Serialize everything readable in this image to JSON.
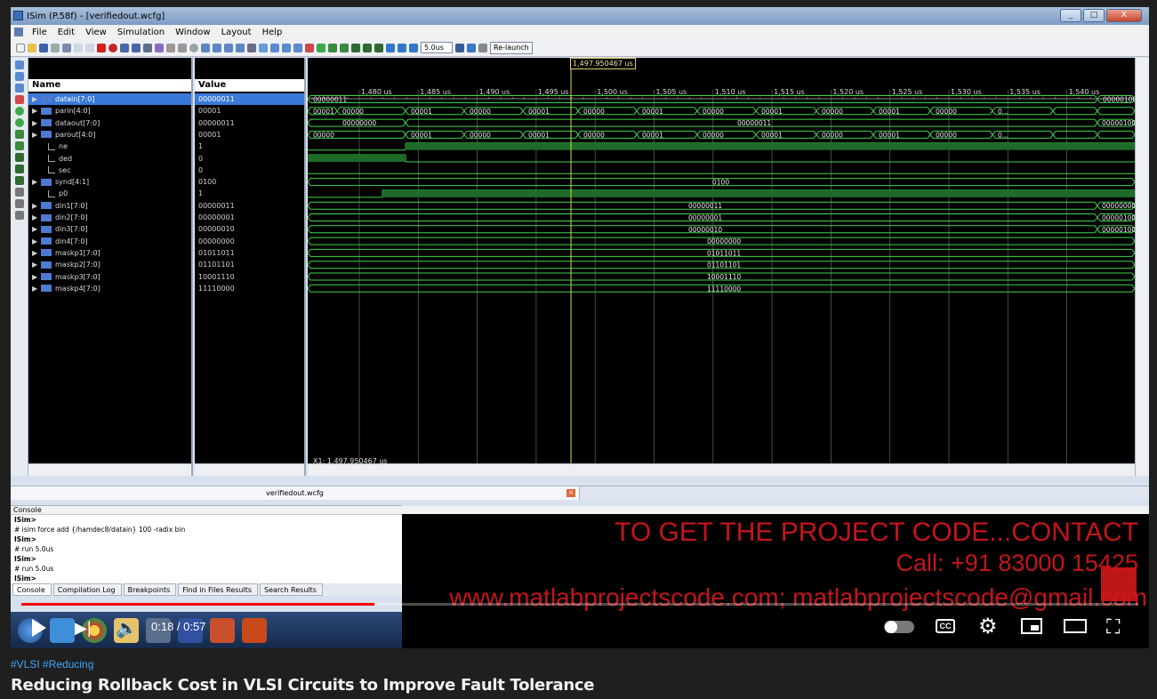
{
  "window": {
    "title": "ISim (P.58f) - [verifiedout.wcfg]",
    "controls": [
      "_",
      "□",
      "X"
    ]
  },
  "menu": [
    "File",
    "Edit",
    "View",
    "Simulation",
    "Window",
    "Layout",
    "Help"
  ],
  "toolbar": {
    "run_time": "5.0us",
    "relaunch_label": "Re-launch"
  },
  "panes": {
    "name_header": "Name",
    "value_header": "Value"
  },
  "signals": [
    {
      "name": "datain[7:0]",
      "value": "00000011",
      "bus": true,
      "selected": true
    },
    {
      "name": "parin[4:0]",
      "value": "00001",
      "bus": true
    },
    {
      "name": "dataout[7:0]",
      "value": "00000011",
      "bus": true
    },
    {
      "name": "parout[4:0]",
      "value": "00001",
      "bus": true
    },
    {
      "name": "ne",
      "value": "1",
      "bus": false
    },
    {
      "name": "ded",
      "value": "0",
      "bus": false
    },
    {
      "name": "sec",
      "value": "0",
      "bus": false
    },
    {
      "name": "synd[4:1]",
      "value": "0100",
      "bus": true
    },
    {
      "name": "p0",
      "value": "1",
      "bus": false
    },
    {
      "name": "din1[7:0]",
      "value": "00000011",
      "bus": true
    },
    {
      "name": "din2[7:0]",
      "value": "00000001",
      "bus": true
    },
    {
      "name": "din3[7:0]",
      "value": "00000010",
      "bus": true
    },
    {
      "name": "din4[7:0]",
      "value": "00000000",
      "bus": true
    },
    {
      "name": "maskp1[7:0]",
      "value": "01011011",
      "bus": true
    },
    {
      "name": "maskp2[7:0]",
      "value": "01101101",
      "bus": true
    },
    {
      "name": "maskp3[7:0]",
      "value": "10001110",
      "bus": true
    },
    {
      "name": "maskp4[7:0]",
      "value": "11110000",
      "bus": true
    }
  ],
  "timeline": {
    "ticks": [
      "1,480 us",
      "1,485 us",
      "1,490 us",
      "1,495 us",
      "1,500 us",
      "1,505 us",
      "1,510 us",
      "1,515 us",
      "1,520 us",
      "1,525 us",
      "1,530 us",
      "1,535 us",
      "1,540 us"
    ],
    "cursor_label": "1,497.950467 us",
    "cursor_readout": "X1: 1,497.950467 us"
  },
  "waves": {
    "datain_center": "00000011",
    "datain_end": "00000100",
    "parin_labels": [
      "00001",
      "00000",
      "00001",
      "00000",
      "00001",
      "00000",
      "00001",
      "00000",
      "00001",
      "00000",
      "00001",
      "00000",
      "0..."
    ],
    "dataout_left": "00000000",
    "dataout_mid": "00000011",
    "dataout_end": "00000100",
    "parout_labels": [
      "00000",
      "00001",
      "00000",
      "00001",
      "00000",
      "00001",
      "00000",
      "00001",
      "00000",
      "00001",
      "00000",
      "0..."
    ],
    "synd": "0100",
    "din1": "00000011",
    "din1_end": "00000000",
    "din2": "00000001",
    "din2_end": "00000100",
    "din3": "00000010",
    "din3_end": "00000100",
    "din4": "00000000",
    "maskp1": "01011011",
    "maskp2": "01101101",
    "maskp3": "10001110",
    "maskp4": "11110000"
  },
  "doc_tab": "verifiedout.wcfg",
  "console": {
    "title": "Console",
    "lines": [
      {
        "text": "ISim>",
        "bold": true
      },
      {
        "text": "# isim force add {/hamdec8/datain} 100 -radix bin",
        "bold": false
      },
      {
        "text": "ISim>",
        "bold": true
      },
      {
        "text": "# run 5.0us",
        "bold": false
      },
      {
        "text": "ISim>",
        "bold": true
      },
      {
        "text": "# run 5.0us",
        "bold": false
      },
      {
        "text": "ISim>",
        "bold": true
      }
    ],
    "tabs": [
      "Console",
      "Compilation Log",
      "Breakpoints",
      "Find in Files Results",
      "Search Results"
    ]
  },
  "overlay": {
    "line1": "TO GET THE PROJECT CODE...CONTACT",
    "line2": "Call: +91 83000 15425",
    "line3": "www.matlabprojectscode.com; matlabprojectscode@gmail.com"
  },
  "player": {
    "time": "0:18 / 0:57",
    "progress": 0.316,
    "cc_label": "CC"
  },
  "video": {
    "tags": "#VLSI #Reducing",
    "title": "Reducing Rollback Cost in VLSI Circuits to Improve Fault Tolerance"
  },
  "colors": {
    "wave_green": "#3cd64a",
    "cursor_yellow": "#e6d25a",
    "overlay_red": "#c4151b",
    "progress_red": "#ff0000",
    "selection_blue": "#3879d9"
  }
}
